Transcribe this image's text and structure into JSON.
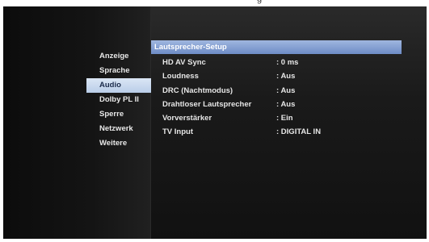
{
  "topbar": {
    "fragment": "g"
  },
  "sidebar": {
    "items": [
      {
        "label": "Anzeige"
      },
      {
        "label": "Sprache"
      },
      {
        "label": "Audio"
      },
      {
        "label": "Dolby PL II"
      },
      {
        "label": "Sperre"
      },
      {
        "label": "Netzwerk"
      },
      {
        "label": "Weitere"
      }
    ],
    "active_index": 2
  },
  "panel": {
    "title": "Lautsprecher-Setup",
    "rows": [
      {
        "label": "HD AV Sync",
        "value": ": 0 ms"
      },
      {
        "label": "Loudness",
        "value": ": Aus"
      },
      {
        "label": "DRC (Nachtmodus)",
        "value": ": Aus"
      },
      {
        "label": "Drahtloser Lautsprecher",
        "value": ": Aus"
      },
      {
        "label": "Vorverstärker",
        "value": ": Ein"
      },
      {
        "label": "TV Input",
        "value": ": DIGITAL IN"
      }
    ]
  },
  "colors": {
    "highlight": "#b9cde8",
    "header": "#6e8cc6",
    "background": "#0c0c0c",
    "text": "#e6e6e6"
  }
}
